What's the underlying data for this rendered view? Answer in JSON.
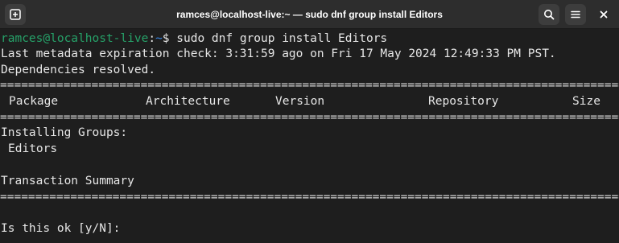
{
  "window": {
    "title": "ramces@localhost-live:~ — sudo dnf group install Editors",
    "icons": [
      "new-tab-icon",
      "search-icon",
      "hamburger-menu-icon",
      "close-icon"
    ]
  },
  "terminal": {
    "prompt_user": "ramces@localhost-live",
    "prompt_sep": ":",
    "prompt_dir": "~",
    "prompt_symbol": "$",
    "command": " sudo dnf group install Editors",
    "metadata_line": "Last metadata expiration check: 3:31:59 ago on Fri 17 May 2024 12:49:33 PM PST.",
    "deps_line": "Dependencies resolved.",
    "separator": "================================================================================================",
    "table_headers": {
      "package": "Package",
      "architecture": "Architecture",
      "version": "Version",
      "repository": "Repository",
      "size": "Size"
    },
    "installing_groups": "Installing Groups:",
    "group_name": "Editors",
    "transaction_summary": "Transaction Summary",
    "confirm_prompt": "Is this ok [y/N]: "
  },
  "colors": {
    "background": "#1e1e1e",
    "titlebar": "#2d2d2d",
    "prompt_user": "#26a269",
    "prompt_dir": "#3584e4",
    "text": "#e6e6e6"
  }
}
